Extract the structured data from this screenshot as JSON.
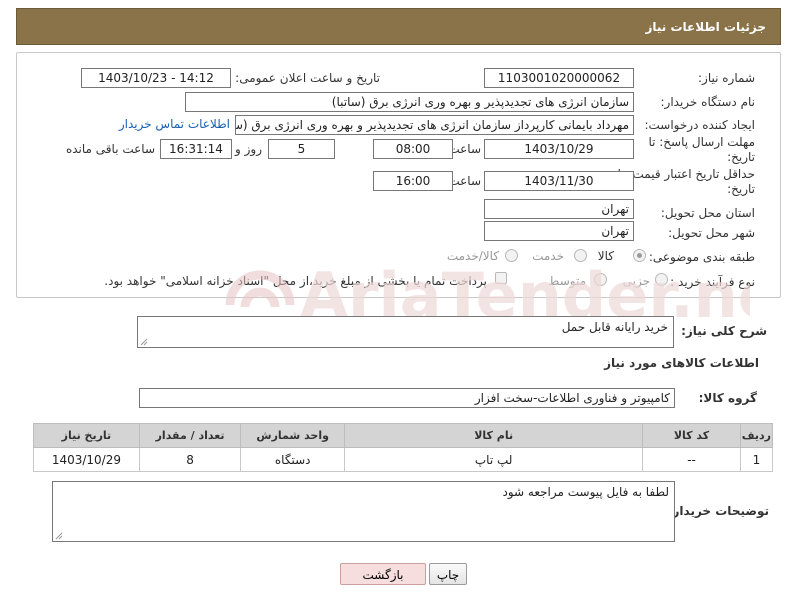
{
  "header": {
    "title": "جزئیات اطلاعات نیاز"
  },
  "form": {
    "need_number": {
      "label": "شماره نیاز:",
      "value": "1103001020000062"
    },
    "announce": {
      "label": "تاریخ و ساعت اعلان عمومی:",
      "value": "1403/10/23 - 14:12"
    },
    "buyer_org": {
      "label": "نام دستگاه خریدار:",
      "value": "سازمان انرژی های تجدیدپذیر و بهره وری انرژی برق (ساتبا)"
    },
    "creator": {
      "label": "ایجاد کننده درخواست:",
      "value": "مهرداد بایمانی کارپرداز سازمان انرژی های تجدیدپذیر و بهره وری انرژی برق (ساتبا)",
      "contact_link": "اطلاعات تماس خریدار"
    },
    "deadline": {
      "label_line1": "مهلت ارسال پاسخ: تا",
      "label_line2": "تاریخ:",
      "date": "1403/10/29",
      "time_label": "ساعت",
      "time": "08:00",
      "days": "5",
      "days_label": "روز و",
      "remaining": "16:31:14",
      "remaining_label": "ساعت باقی مانده"
    },
    "validity": {
      "label_line1": "حداقل تاریخ اعتبار قیمت: تا",
      "label_line2": "تاریخ:",
      "date": "1403/11/30",
      "time_label": "ساعت",
      "time": "16:00"
    },
    "province": {
      "label": "استان محل تحویل:",
      "value": "تهران"
    },
    "city": {
      "label": "شهر محل تحویل:",
      "value": "تهران"
    },
    "category": {
      "label": "طبقه بندی موضوعی:",
      "options": [
        "کالا",
        "خدمت",
        "کالا/خدمت"
      ],
      "selected": "کالا"
    },
    "process": {
      "label": "نوع فرآیند خرید :",
      "options": [
        "جزیی",
        "متوسط"
      ],
      "payment_note": "پرداخت تمام یا بخشی از مبلغ خرید،از محل \"اسناد خزانه اسلامی\" خواهد بود."
    }
  },
  "description": {
    "label": "شرح کلی نیاز:",
    "value": "خرید رایانه قابل حمل"
  },
  "goods_section": {
    "title": "اطلاعات کالاهای مورد نیاز",
    "group_label": "گروه کالا:",
    "group_value": "کامپیوتر و فناوری اطلاعات-سخت افزار"
  },
  "table": {
    "headers": [
      "ردیف",
      "کد کالا",
      "نام کالا",
      "واحد شمارش",
      "تعداد / مقدار",
      "تاریخ نیاز"
    ],
    "rows": [
      {
        "row": "1",
        "code": "--",
        "name": "لپ تاپ",
        "unit": "دستگاه",
        "qty": "8",
        "date": "1403/10/29"
      }
    ]
  },
  "buyer_notes": {
    "label": "توضیحات خریدار:",
    "value": "لطفا به فایل پیوست مراجعه شود"
  },
  "buttons": {
    "print": "چاپ",
    "back": "بازگشت"
  },
  "colors": {
    "header_bg": "#8a7348",
    "back_button_bg": "#f6dede",
    "link": "#1a5fb4"
  }
}
